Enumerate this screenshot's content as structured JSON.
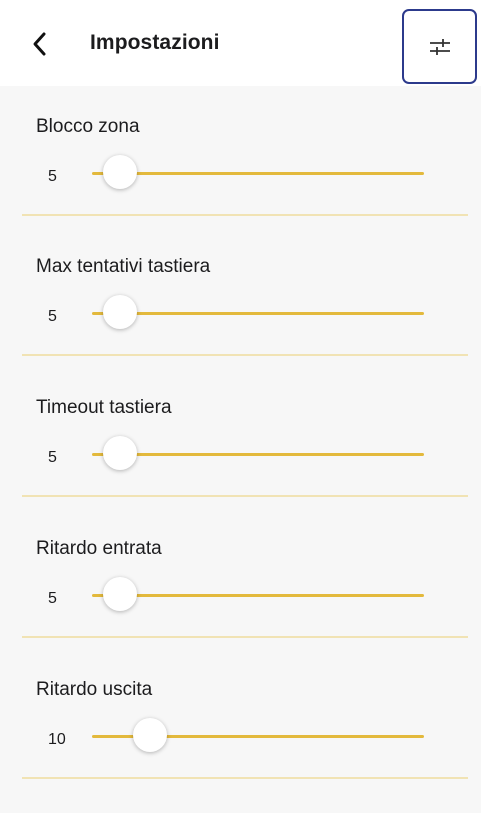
{
  "header": {
    "title": "Impostazioni",
    "back_icon": "chevron-left-icon",
    "filter_icon": "sliders-icon",
    "filter_border_color": "#2c3a8c"
  },
  "accent_color": "#e3b93c",
  "settings": [
    {
      "label": "Blocco zona",
      "value": "5",
      "fraction": 0.0
    },
    {
      "label": "Max tentativi tastiera",
      "value": "5",
      "fraction": 0.0
    },
    {
      "label": "Timeout tastiera",
      "value": "5",
      "fraction": 0.0
    },
    {
      "label": "Ritardo entrata",
      "value": "5",
      "fraction": 0.0
    },
    {
      "label": "Ritardo uscita",
      "value": "10",
      "fraction": 0.1
    }
  ]
}
